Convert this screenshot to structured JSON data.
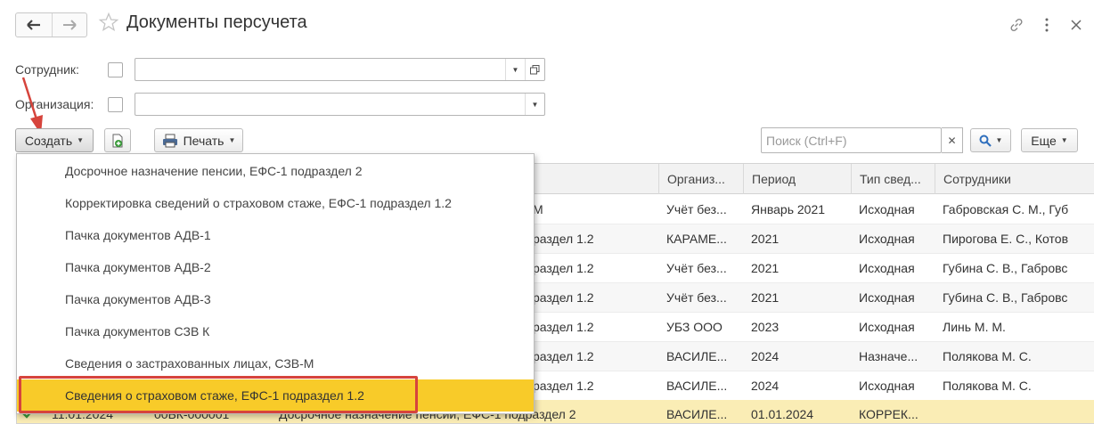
{
  "header": {
    "title": "Документы персучета"
  },
  "filters": {
    "employee_label": "Сотрудник:",
    "employee_value": "",
    "organization_label": "Организация:",
    "organization_value": ""
  },
  "toolbar": {
    "create_label": "Создать",
    "print_label": "Печать",
    "search_placeholder": "Поиск (Ctrl+F)",
    "more_label": "Еще"
  },
  "table": {
    "columns": [
      "Организ...",
      "Период",
      "Тип свед...",
      "Сотрудники"
    ],
    "rows": [
      {
        "doc": "М",
        "org": "Учёт без...",
        "period": "Январь 2021",
        "type": "Исходная",
        "employees": "Габровская С. М., Губ"
      },
      {
        "doc": "раздел 1.2",
        "org": "КАРАМЕ...",
        "period": "2021",
        "type": "Исходная",
        "employees": "Пирогова Е. С., Котов"
      },
      {
        "doc": "раздел 1.2",
        "org": "Учёт без...",
        "period": "2021",
        "type": "Исходная",
        "employees": "Губина С. В., Габровс"
      },
      {
        "doc": "раздел 1.2",
        "org": "Учёт без...",
        "period": "2021",
        "type": "Исходная",
        "employees": "Губина С. В., Габровс"
      },
      {
        "doc": "раздел 1.2",
        "org": "УБЗ ООО",
        "period": "2023",
        "type": "Исходная",
        "employees": "Линь М. М."
      },
      {
        "doc": "раздел 1.2",
        "org": "ВАСИЛЕ...",
        "period": "2024",
        "type": "Назначе...",
        "employees": "Полякова М. С."
      },
      {
        "doc": "раздел 1.2",
        "org": "ВАСИЛЕ...",
        "period": "2024",
        "type": "Исходная",
        "employees": "Полякова М. С."
      },
      {
        "date": "11.01.2024",
        "number": "00БК-000001",
        "doc": "Досрочное назначение пенсии, ЕФС-1 подраздел 2",
        "org": "ВАСИЛЕ...",
        "period": "01.01.2024",
        "type": "КОРРЕК...",
        "employees": ""
      }
    ]
  },
  "menu": {
    "items": [
      "Досрочное назначение пенсии, ЕФС-1 подраздел 2",
      "Корректировка сведений о страховом стаже, ЕФС-1 подраздел 1.2",
      "Пачка документов АДВ-1",
      "Пачка документов АДВ-2",
      "Пачка документов АДВ-3",
      "Пачка документов СЗВ К",
      "Сведения о застрахованных лицах, СЗВ-М",
      "Сведения о страховом стаже, ЕФС-1 подраздел 1.2"
    ],
    "highlighted_index": 7
  },
  "colors": {
    "highlight": "#f8cb29",
    "selected_row": "#faedb5",
    "annotation": "#d6443c",
    "search_icon": "#2f6fbd"
  },
  "icons": [
    "arrow-left-icon",
    "arrow-right-icon",
    "star-icon",
    "link-icon",
    "more-icon",
    "close-icon",
    "doc-add-icon",
    "printer-icon",
    "search-icon",
    "checkmark-icon"
  ]
}
